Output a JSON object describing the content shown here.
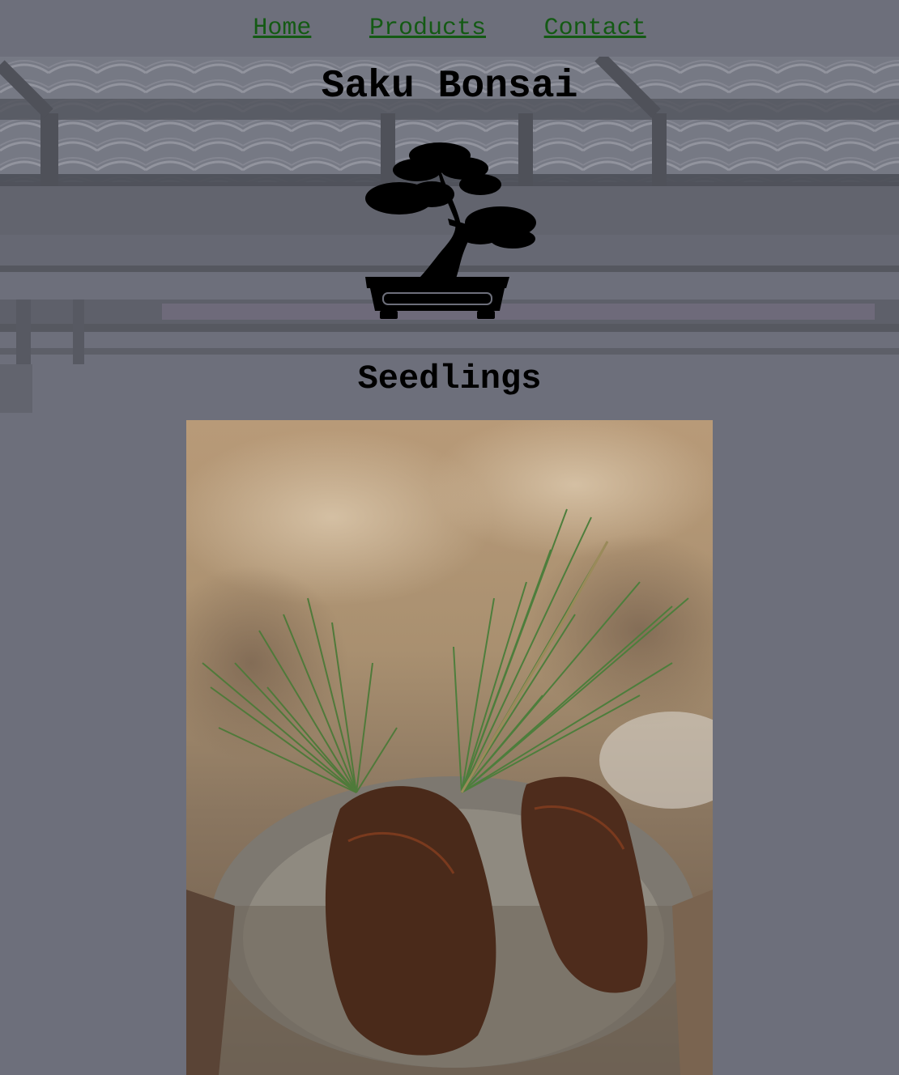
{
  "nav": {
    "home": "Home",
    "products": "Products",
    "contact": "Contact"
  },
  "header": {
    "site_title": "Saku Bonsai",
    "logo_icon": "bonsai-tree-icon"
  },
  "section": {
    "title": "Seedlings",
    "image_icon": "pine-seedling-photo"
  },
  "colors": {
    "background": "#6d6f7b",
    "nav_link": "#145a14",
    "title_text": "#000000"
  }
}
